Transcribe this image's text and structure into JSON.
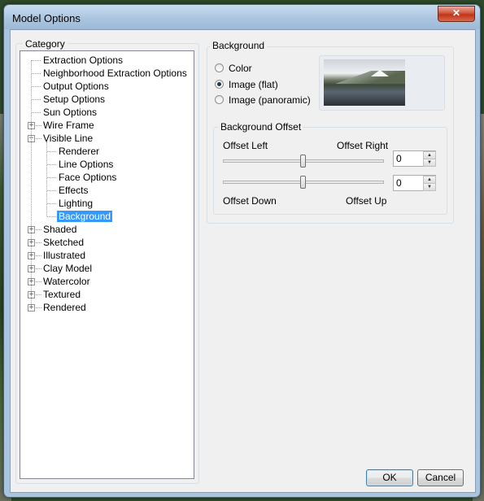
{
  "window": {
    "title": "Model Options",
    "close_label": "✕"
  },
  "category": {
    "label": "Category",
    "items": [
      {
        "label": "Extraction Options",
        "depth": 0,
        "expander": null
      },
      {
        "label": "Neighborhood Extraction Options",
        "depth": 0,
        "expander": null
      },
      {
        "label": "Output Options",
        "depth": 0,
        "expander": null
      },
      {
        "label": "Setup Options",
        "depth": 0,
        "expander": null
      },
      {
        "label": "Sun Options",
        "depth": 0,
        "expander": null
      },
      {
        "label": "Wire Frame",
        "depth": 0,
        "expander": "+"
      },
      {
        "label": "Visible Line",
        "depth": 0,
        "expander": "-"
      },
      {
        "label": "Renderer",
        "depth": 1,
        "expander": null
      },
      {
        "label": "Line Options",
        "depth": 1,
        "expander": null
      },
      {
        "label": "Face Options",
        "depth": 1,
        "expander": null
      },
      {
        "label": "Effects",
        "depth": 1,
        "expander": null
      },
      {
        "label": "Lighting",
        "depth": 1,
        "expander": null
      },
      {
        "label": "Background",
        "depth": 1,
        "expander": null,
        "selected": true
      },
      {
        "label": "Shaded",
        "depth": 0,
        "expander": "+"
      },
      {
        "label": "Sketched",
        "depth": 0,
        "expander": "+"
      },
      {
        "label": "Illustrated",
        "depth": 0,
        "expander": "+"
      },
      {
        "label": "Clay Model",
        "depth": 0,
        "expander": "+"
      },
      {
        "label": "Watercolor",
        "depth": 0,
        "expander": "+"
      },
      {
        "label": "Textured",
        "depth": 0,
        "expander": "+"
      },
      {
        "label": "Rendered",
        "depth": 0,
        "expander": "+"
      }
    ]
  },
  "background": {
    "label": "Background",
    "options": [
      {
        "label": "Color",
        "checked": false
      },
      {
        "label": "Image (flat)",
        "checked": true
      },
      {
        "label": "Image (panoramic)",
        "checked": false
      }
    ]
  },
  "offset": {
    "label": "Background Offset",
    "left_label": "Offset Left",
    "right_label": "Offset Right",
    "down_label": "Offset Down",
    "up_label": "Offset Up",
    "horizontal_value": "0",
    "vertical_value": "0"
  },
  "buttons": {
    "ok": "OK",
    "cancel": "Cancel"
  },
  "colors": {
    "selection": "#3399ff",
    "title_bar": "#a9c4df",
    "close_button": "#c0341a"
  }
}
